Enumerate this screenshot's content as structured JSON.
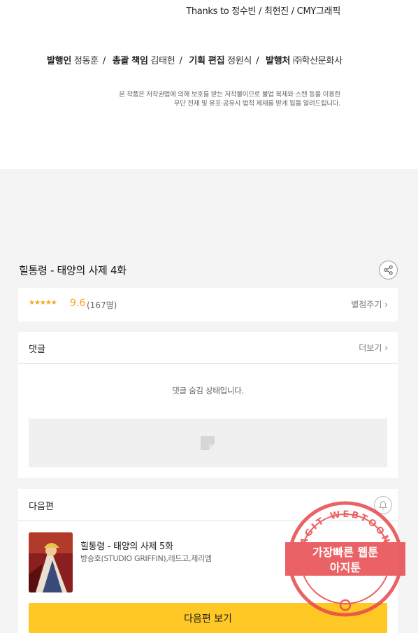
{
  "credits": {
    "thanks": "Thanks to 정수빈 / 최현진 / CMY그래픽",
    "publisher_label": "발행인",
    "publisher": "정동훈",
    "chief_label": "총괄 책임",
    "chief": "김태헌",
    "editor_label": "기획 편집",
    "editor": "정원식",
    "issuer_label": "발행처",
    "issuer": "㈜학산문화사",
    "notice_line1": "본 작품은 저작권법에 의해 보호를 받는 저작물이므로 불법 복제와 스캔 등을 이용한",
    "notice_line2": "무단 전재 및 유포·공유시 법적 제재를 받게 됨을 알려드립니다."
  },
  "episode": {
    "title": "힐통령 - 태양의 사제 4화"
  },
  "rating": {
    "stars": "★★★★★",
    "score": "9.6",
    "count": "(167명)",
    "rate_label": "별점주기 ›"
  },
  "comments": {
    "title": "댓글",
    "more_label": "더보기 ›",
    "hidden_message": "댓글 숨김 상태입니다."
  },
  "next": {
    "header": "다음편",
    "title": "힐통령 - 태양의 사제 5화",
    "authors": "방승호(STUDIO GRIFFIN),레드고,제리엠",
    "button_label": "다음편 보기"
  },
  "watermark": {
    "ring_text": "AGIT WEBTOON",
    "line1": "가장빠른 웹툰",
    "line2": "아지툰"
  },
  "colors": {
    "accent": "#ffc824",
    "star": "#f5a623",
    "stamp": "#e8474c"
  }
}
